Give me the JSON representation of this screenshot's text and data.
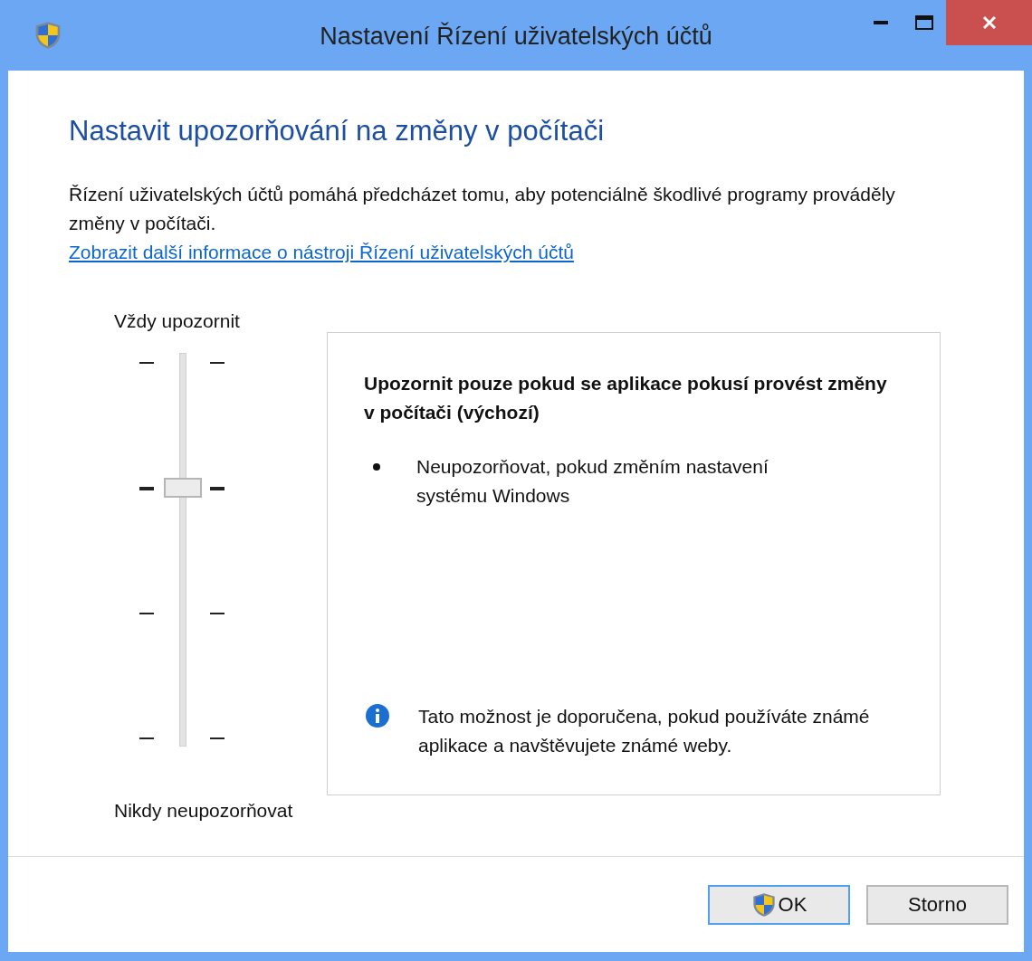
{
  "window": {
    "title": "Nastavení Řízení uživatelských účtů"
  },
  "heading": "Nastavit upozorňování na změny v počítači",
  "intro": "Řízení uživatelských účtů pomáhá předcházet tomu, aby potenciálně škodlivé programy prováděly změny v počítači.",
  "link": "Zobrazit další informace o nástroji Řízení uživatelských účtů",
  "slider": {
    "top_label": "Vždy upozornit",
    "bottom_label": "Nikdy neupozorňovat",
    "level": 0.667
  },
  "description": {
    "title": "Upozornit pouze pokud se aplikace pokusí provést změny v počítači (výchozí)",
    "bullets": [
      "Neupozorňovat, pokud změním nastavení systému Windows"
    ],
    "note": "Tato možnost je doporučena, pokud používáte známé aplikace a navštěvujete známé weby."
  },
  "buttons": [
    {
      "label": "OK",
      "kind": "shield",
      "focused": true
    },
    {
      "label": "Storno",
      "kind": "plain",
      "focused": false
    }
  ]
}
